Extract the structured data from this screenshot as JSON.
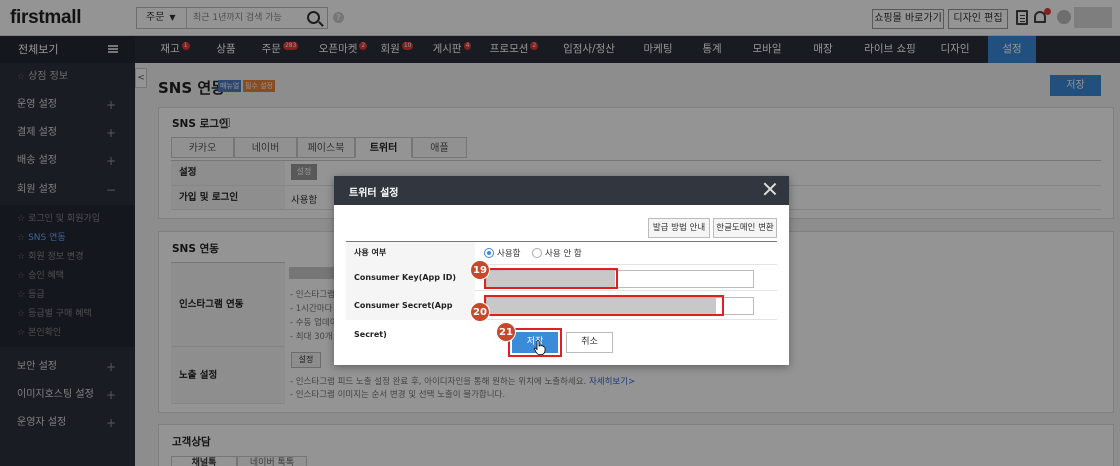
{
  "topbar": {
    "logo": "firstmall",
    "search": {
      "select_value": "주문",
      "placeholder": "최근 1년까지 검색 가능"
    },
    "shop_button": "쇼핑몰 바로가기",
    "design_button": "디자인 편집"
  },
  "nav": {
    "all_label": "전체보기",
    "items": [
      {
        "label": "재고",
        "badge": "1"
      },
      {
        "label": "상품",
        "badge": ""
      },
      {
        "label": "주문",
        "badge": "283"
      },
      {
        "label": "오픈마켓",
        "badge": "2"
      },
      {
        "label": "회원",
        "badge": "10"
      },
      {
        "label": "게시판",
        "badge": "4"
      },
      {
        "label": "프로모션",
        "badge": "2"
      },
      {
        "label": "입점사/정산",
        "badge": ""
      },
      {
        "label": "마케팅",
        "badge": ""
      },
      {
        "label": "통계",
        "badge": ""
      },
      {
        "label": "모바일",
        "badge": ""
      },
      {
        "label": "매장",
        "badge": ""
      },
      {
        "label": "라이브 쇼핑",
        "badge": ""
      },
      {
        "label": "디자인",
        "badge": ""
      },
      {
        "label": "설정",
        "badge": "",
        "active": true
      }
    ]
  },
  "sidebar": {
    "top_item": "상점 정보",
    "groups": [
      {
        "label": "운영 설정",
        "icon": "+"
      },
      {
        "label": "결제 설정",
        "icon": "+"
      },
      {
        "label": "배송 설정",
        "icon": "+"
      },
      {
        "label": "회원 설정",
        "icon": "−"
      }
    ],
    "member_sub": [
      "로그인 및 회원가입",
      "SNS 연동",
      "회원 정보 변경",
      "승인 혜택",
      "등급",
      "등급별 구매 혜택",
      "본인확인"
    ],
    "member_sub_active": "SNS 연동",
    "bottom_groups": [
      {
        "label": "보안 설정",
        "icon": "+"
      },
      {
        "label": "이미지호스팅 설정",
        "icon": "+"
      },
      {
        "label": "운영자 설정",
        "icon": "+"
      }
    ]
  },
  "page": {
    "title": "SNS 연동",
    "tag_manual": "매뉴얼",
    "tag_required": "필수 설정",
    "save_label": "저장",
    "collapse_icon": "<"
  },
  "sns_login": {
    "title": "SNS 로그인",
    "help_icon": "?",
    "tabs": [
      "카카오",
      "네이버",
      "페이스북",
      "트위터",
      "애플"
    ],
    "active_tab": "트위터",
    "row_setting_label": "설정",
    "row_setting_button": "설정",
    "row_join_label": "가입 및 로그인",
    "row_join_value": "사용함"
  },
  "sns_link": {
    "title": "SNS 연동",
    "instagram_label": "인스타그램 연동",
    "instagram_notes": [
      "- 인스타그램",
      "- 1시간마다",
      "- 수동 업데이",
      "- 최대 30개"
    ],
    "exposure_label": "노출 설정",
    "exposure_button": "설정",
    "exposure_note1": "- 인스타그램 피드 노출 설정 완료 후, 아이디자인을 통해 원하는 위치에 노출하세요.",
    "exposure_link": "자세히보기>",
    "exposure_note2": "- 인스타그램 이미지는 순서 변경 및 선택 노출이 불가합니다."
  },
  "cs": {
    "title": "고객상담",
    "tab1": "채널톡",
    "tab2": "네이버 톡톡"
  },
  "modal": {
    "title": "트위터 설정",
    "guide_button": "발급 방법 안내",
    "convert_button": "한글도메인 변환",
    "use_label": "사용 여부",
    "use_on": "사용함",
    "use_off": "사용 안 함",
    "use_selected": "사용함",
    "key_label": "Consumer Key(App ID)",
    "secret_label": "Consumer Secret(App Secret)",
    "save_button": "저장",
    "cancel_button": "취소"
  },
  "steps": {
    "s19": "19",
    "s20": "20",
    "s21": "21"
  },
  "colors": {
    "accent": "#3c8bd9",
    "nav_bg": "#2a2f3a",
    "sidebar_bg": "#2c313c",
    "highlight": "#e02020",
    "step_badge": "#c64a2a"
  }
}
